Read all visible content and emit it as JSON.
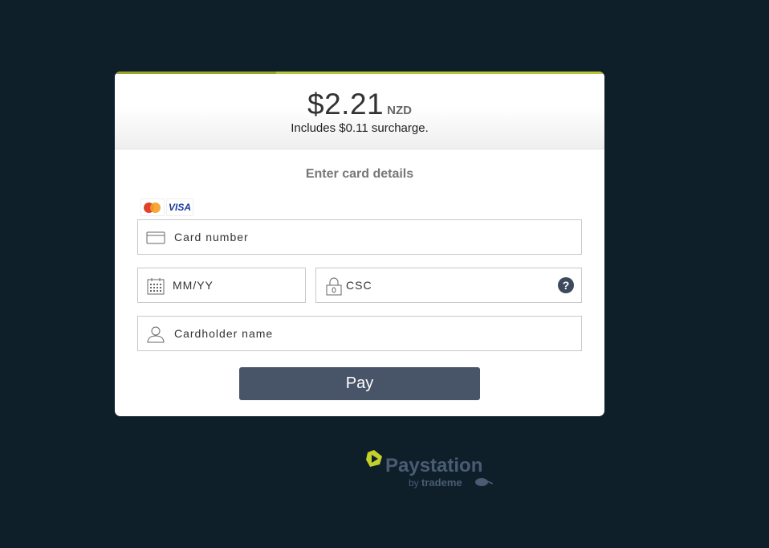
{
  "payment": {
    "amount": "$2.21",
    "currency": "NZD",
    "surcharge_text": "Includes $0.11 surcharge.",
    "progress_fraction": 0.33
  },
  "form": {
    "title": "Enter card details",
    "card_brands": [
      "mastercard-icon",
      "VISA"
    ],
    "card_number": {
      "placeholder": "Card number",
      "value": ""
    },
    "expiry": {
      "placeholder": "MM/YY",
      "value": ""
    },
    "csc": {
      "placeholder": "CSC",
      "value": "",
      "help_label": "?"
    },
    "cardholder_name": {
      "placeholder": "Cardholder name",
      "value": ""
    },
    "pay_label": "Pay"
  },
  "branding": {
    "name": "Paystation",
    "by": "by",
    "parent": "trademe",
    "accent_color": "#c4d12c"
  },
  "colors": {
    "background": "#0e1f2a",
    "button": "#485468",
    "progress": "#b8c53a"
  }
}
